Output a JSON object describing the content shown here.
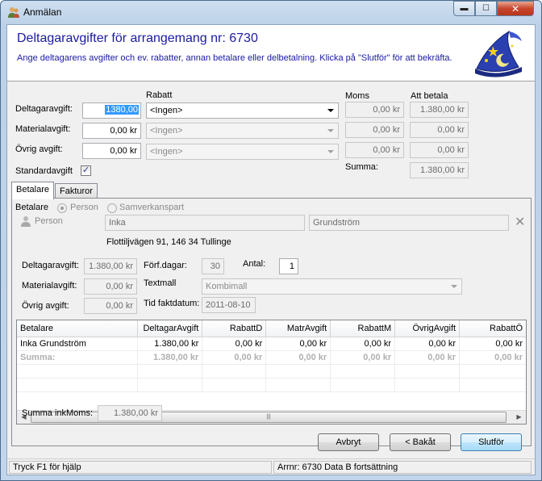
{
  "window": {
    "title": "Anmälan",
    "min_glyph": "▬",
    "max_glyph": "☐",
    "close_glyph": "✕"
  },
  "header": {
    "title": "Deltagaravgifter för arrangemang nr: 6730",
    "description": "Ange deltagarens avgifter och ev. rabatter, annan betalare eller delbetalning. Klicka på \"Slutför\" för att bekräfta."
  },
  "fees": {
    "col_rabatt": "Rabatt",
    "col_moms": "Moms",
    "col_att_betala": "Att betala",
    "rows": [
      {
        "label": "Deltagaravgift:",
        "amount": "1380,00",
        "rabatt": "<Ingen>",
        "moms": "0,00 kr",
        "att_betala": "1.380,00 kr"
      },
      {
        "label": "Materialavgift:",
        "amount": "0,00 kr",
        "rabatt": "<Ingen>",
        "moms": "0,00 kr",
        "att_betala": "0,00 kr"
      },
      {
        "label": "Övrig avgift:",
        "amount": "0,00 kr",
        "rabatt": "<Ingen>",
        "moms": "0,00 kr",
        "att_betala": "0,00 kr"
      }
    ],
    "standard_label": "Standardavgift",
    "standard_checked": "✓",
    "summa_label": "Summa:",
    "summa_value": "1.380,00 kr"
  },
  "tabs": [
    {
      "label": "Betalare"
    },
    {
      "label": "Fakturor"
    }
  ],
  "betalare": {
    "label": "Betalare",
    "radio_person": "Person",
    "radio_samverkan": "Samverkanspart",
    "person_label": "Person",
    "first_name": "Inka",
    "last_name": "Grundström",
    "address": "Flottiljvägen 91, 146 34  Tullinge",
    "clear_glyph": "✕",
    "deltagaravgift_label": "Deltagaravgift:",
    "deltagaravgift_value": "1.380,00 kr",
    "materialavgift_label": "Materialavgift:",
    "materialavgift_value": "0,00 kr",
    "ovrig_label": "Övrig avgift:",
    "ovrig_value": "0,00 kr",
    "forfdagar_label": "Förf.dagar:",
    "forfdagar_value": "30",
    "antal_label": "Antal:",
    "antal_value": "1",
    "textmall_label": "Textmall",
    "textmall_value": "Kombimall",
    "tid_label": "Tid faktdatum:",
    "tid_value": "2011-08-10"
  },
  "grid": {
    "columns": [
      "Betalare",
      "DeltagarAvgift",
      "RabattD",
      "MatrAvgift",
      "RabattM",
      "ÖvrigAvgift",
      "RabattÖ"
    ],
    "rows": [
      [
        "Inka Grundström",
        "1.380,00 kr",
        "0,00 kr",
        "0,00 kr",
        "0,00 kr",
        "0,00 kr",
        "0,00 kr"
      ]
    ],
    "sum_row": [
      "Summa:",
      "1.380,00 kr",
      "0,00 kr",
      "0,00 kr",
      "0,00 kr",
      "0,00 kr",
      "0,00 kr"
    ],
    "scroll_left": "◀",
    "scroll_right": "▶",
    "scroll_grip": "|||"
  },
  "summa_ink_moms": {
    "label": "Summa inkMoms:",
    "value": "1.380,00 kr"
  },
  "buttons": {
    "avbryt": "Avbryt",
    "bakat": "< Bakåt",
    "slutfor": "Slutför"
  },
  "status": {
    "help": "Tryck F1 för hjälp",
    "info": "Arrnr: 6730 Data  B fortsättning"
  }
}
